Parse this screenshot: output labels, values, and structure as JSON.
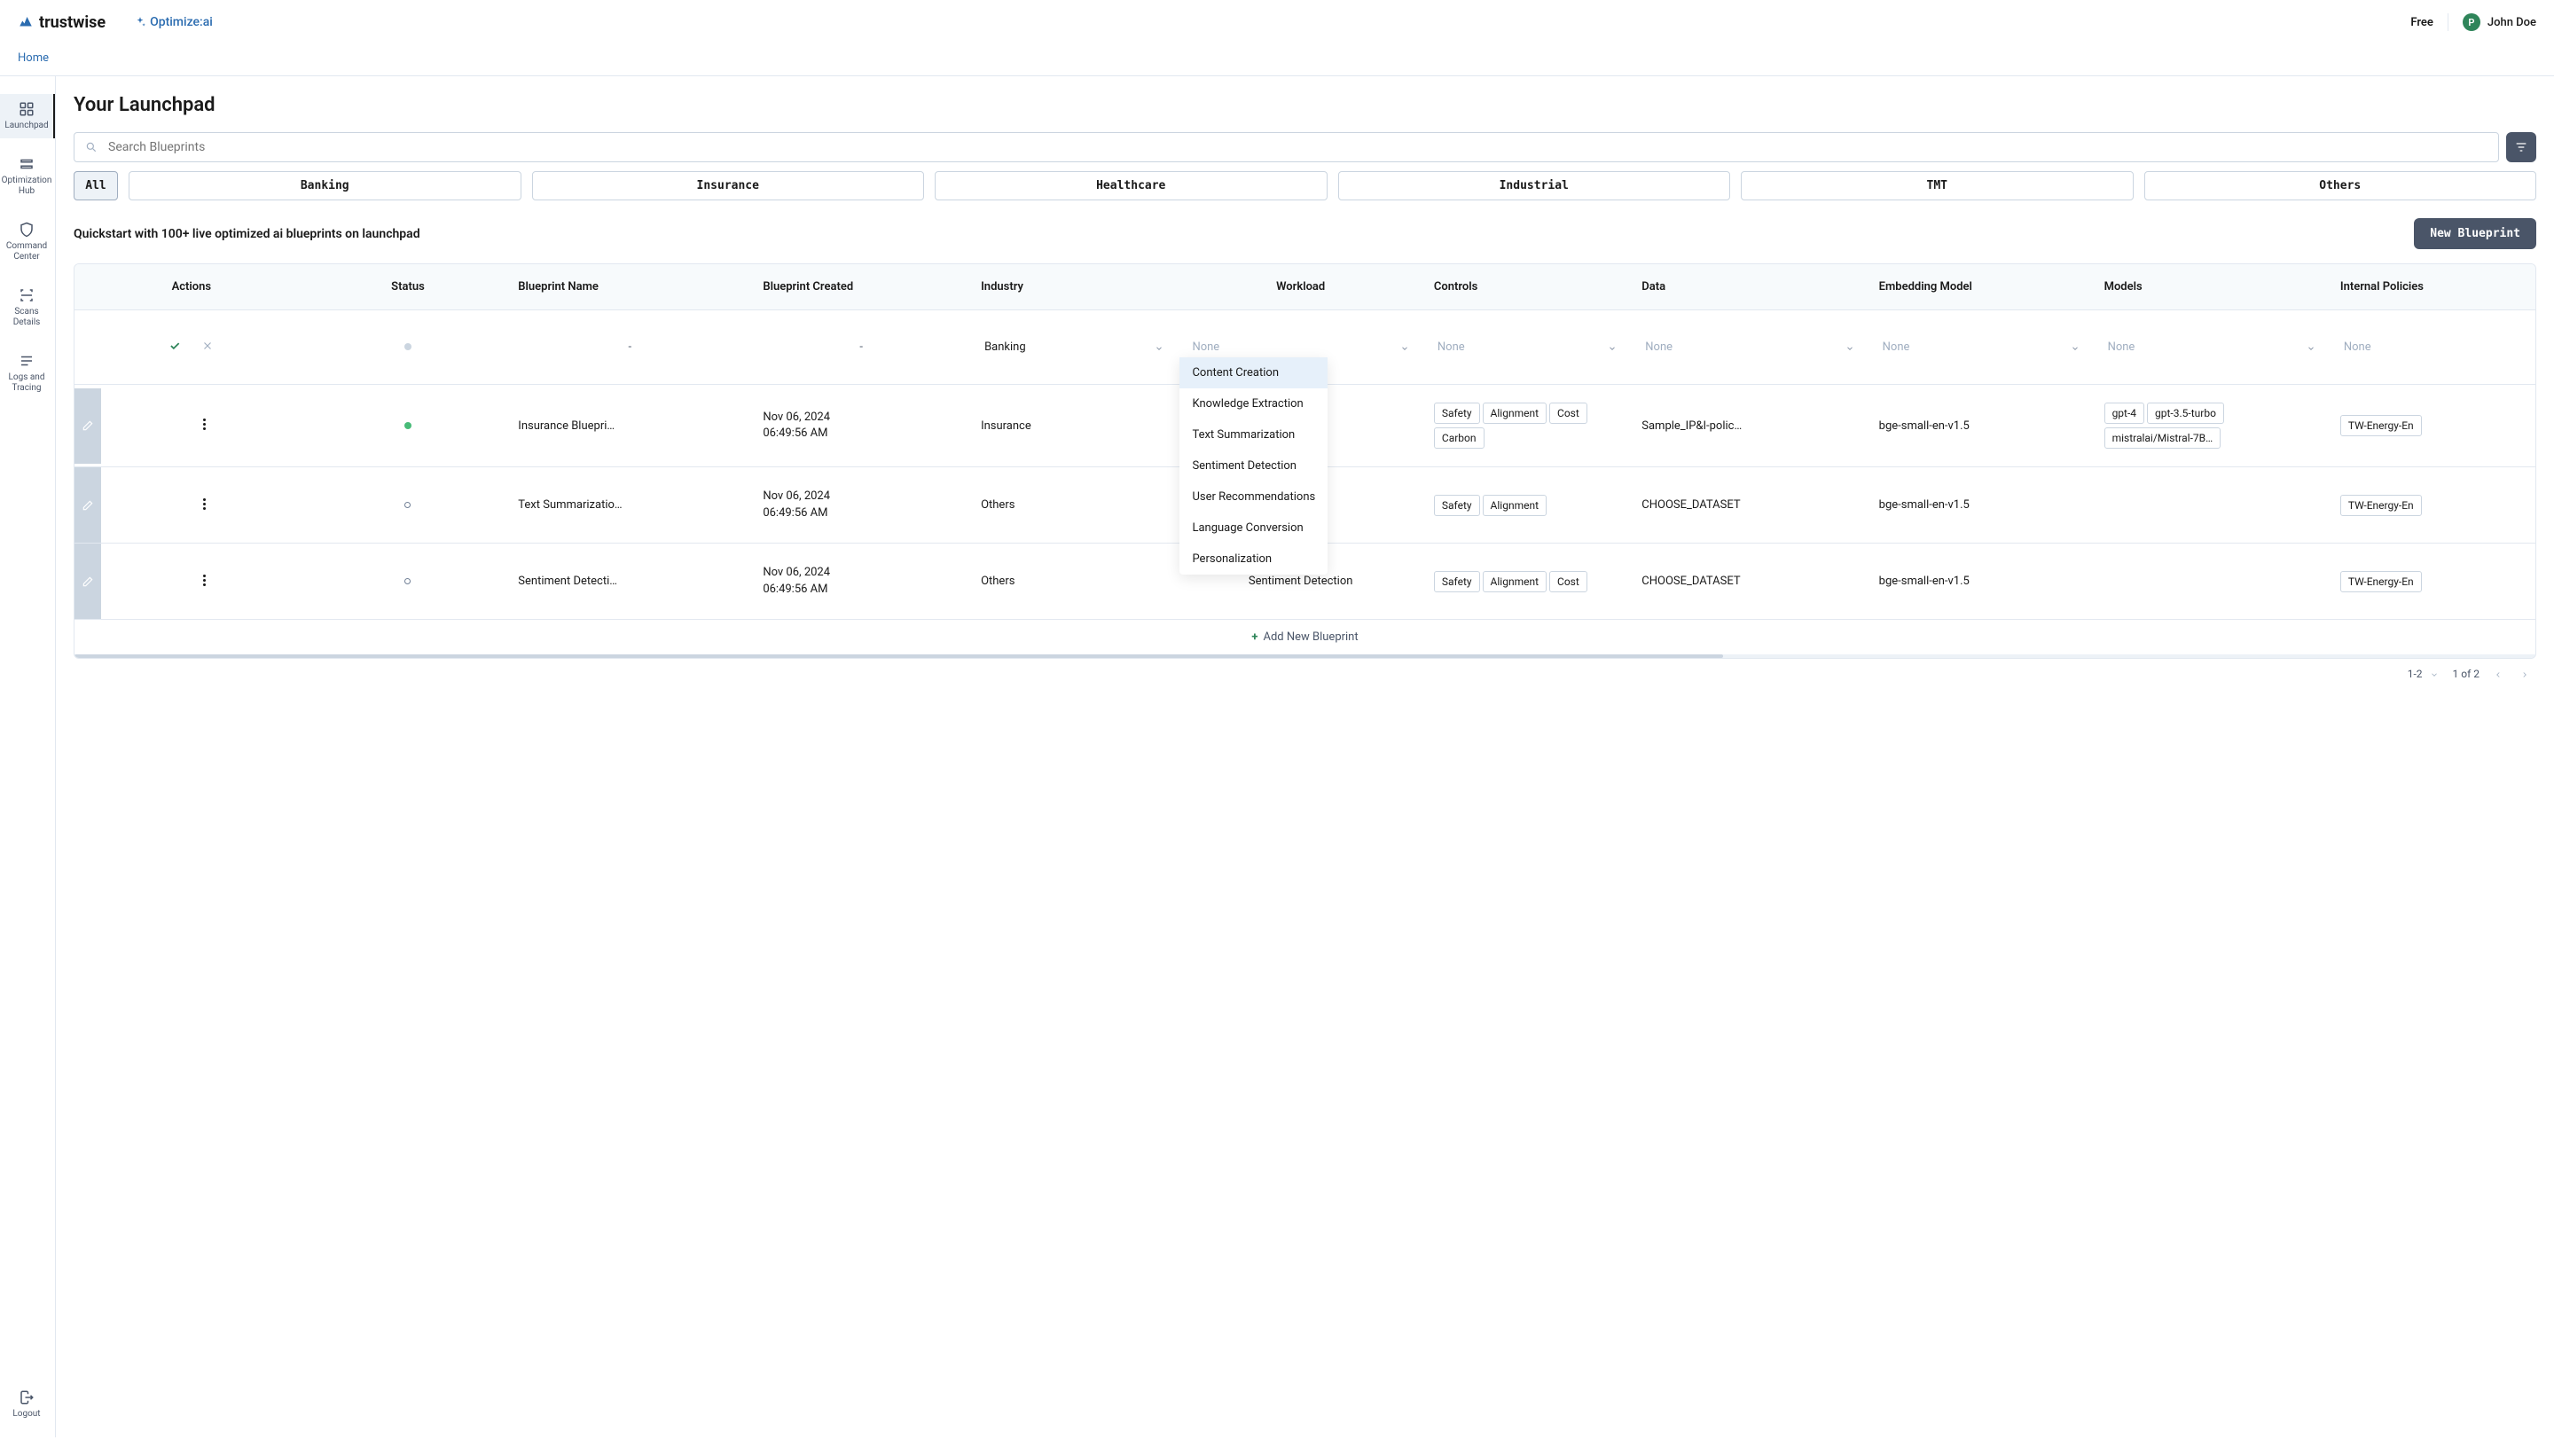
{
  "header": {
    "brand": "trustwise",
    "tagline": "Optimize:ai",
    "plan": "Free",
    "user_initial": "P",
    "user_name": "John Doe"
  },
  "breadcrumb": {
    "home": "Home"
  },
  "sidebar": {
    "items": [
      {
        "id": "launchpad",
        "label": "Launchpad",
        "active": true
      },
      {
        "id": "optimization-hub",
        "label": "Optimization Hub",
        "active": false
      },
      {
        "id": "command-center",
        "label": "Command Center",
        "active": false
      },
      {
        "id": "scans-details",
        "label": "Scans Details",
        "active": false
      },
      {
        "id": "logs-tracing",
        "label": "Logs and Tracing",
        "active": false
      }
    ],
    "logout": "Logout"
  },
  "page": {
    "title": "Your Launchpad",
    "search_placeholder": "Search Blueprints",
    "tabs": [
      "All",
      "Banking",
      "Insurance",
      "Healthcare",
      "Industrial",
      "TMT",
      "Others"
    ],
    "quickstart_text": "Quickstart with 100+ live optimized ai blueprints on launchpad",
    "new_blueprint_btn": "New Blueprint"
  },
  "table": {
    "columns": [
      "Actions",
      "Status",
      "Blueprint Name",
      "Blueprint Created",
      "Industry",
      "Workload",
      "Controls",
      "Data",
      "Embedding Model",
      "Models",
      "Internal Policies"
    ],
    "edit_row": {
      "blueprint_name": "-",
      "blueprint_created": "-",
      "industry": {
        "value": "Banking"
      },
      "workload": {
        "placeholder": "None",
        "options": [
          "Content Creation",
          "Knowledge Extraction",
          "Text Summarization",
          "Sentiment Detection",
          "User Recommendations",
          "Language Conversion",
          "Personalization"
        ]
      },
      "controls_placeholder": "None",
      "data_placeholder": "None",
      "embedding_placeholder": "None",
      "models_placeholder": "None",
      "policies_placeholder": "None"
    },
    "rows": [
      {
        "status": "green",
        "name": "Insurance Bluepri…",
        "created_date": "Nov 06, 2024",
        "created_time": "06:49:56 AM",
        "industry": "Insurance",
        "workload": "",
        "controls": [
          "Safety",
          "Alignment",
          "Cost",
          "Carbon"
        ],
        "data": "Sample_IP&I-polic…",
        "embedding": "bge-small-en-v1.5",
        "models": [
          "gpt-4",
          "gpt-3.5-turbo",
          "mistralai/Mistral-7B…"
        ],
        "policies": "TW-Energy-En"
      },
      {
        "status": "outline",
        "name": "Text Summarizatio…",
        "created_date": "Nov 06, 2024",
        "created_time": "06:49:56 AM",
        "industry": "Others",
        "workload": "",
        "controls": [
          "Safety",
          "Alignment"
        ],
        "data": "CHOOSE_DATASET",
        "embedding": "bge-small-en-v1.5",
        "models": [],
        "policies": "TW-Energy-En"
      },
      {
        "status": "outline",
        "name": "Sentiment Detecti…",
        "created_date": "Nov 06, 2024",
        "created_time": "06:49:56 AM",
        "industry": "Others",
        "workload": "Sentiment Detection",
        "controls": [
          "Safety",
          "Alignment",
          "Cost"
        ],
        "data": "CHOOSE_DATASET",
        "embedding": "bge-small-en-v1.5",
        "models": [],
        "policies": "TW-Energy-En"
      }
    ],
    "add_row": "Add New Blueprint"
  },
  "pagination": {
    "range": "1-2",
    "of": "1 of 2"
  }
}
